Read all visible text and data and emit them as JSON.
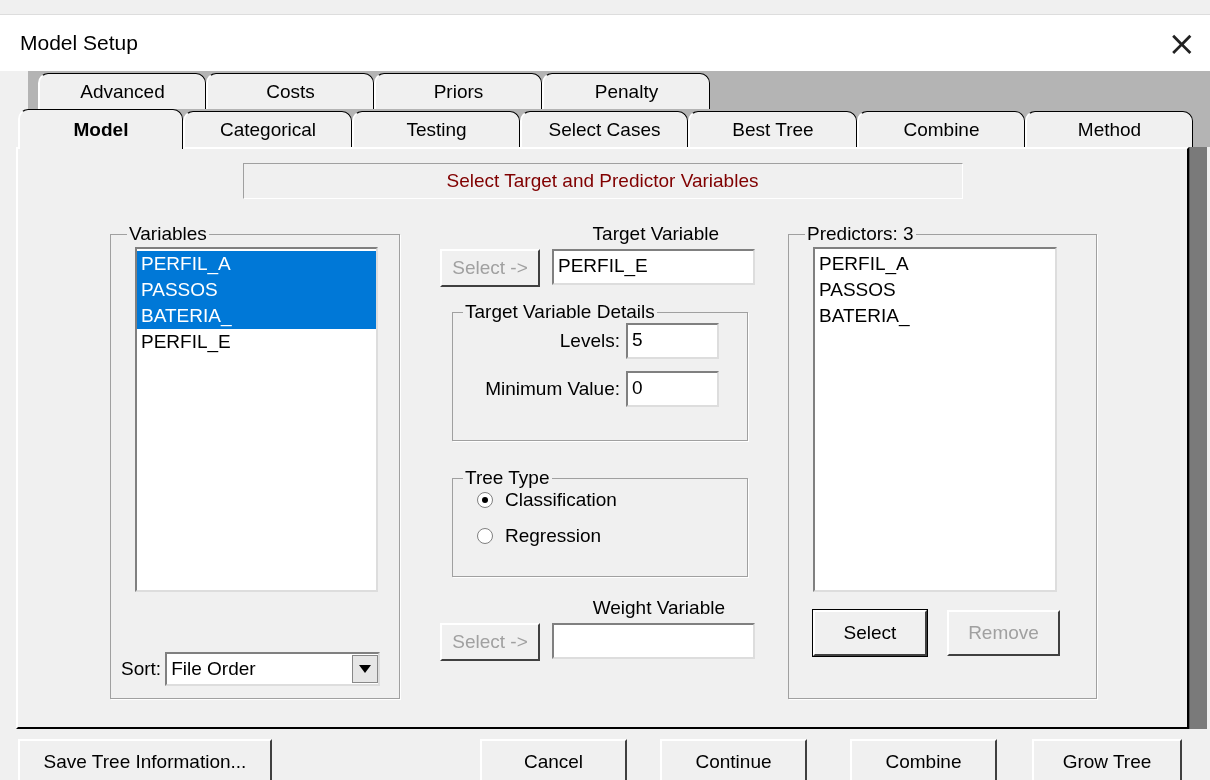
{
  "window": {
    "title": "Model Setup",
    "close": "×"
  },
  "tab_rows": [
    {
      "tabs": [
        {
          "label": "Advanced",
          "selected": false
        },
        {
          "label": "Costs",
          "selected": false
        },
        {
          "label": "Priors",
          "selected": false
        },
        {
          "label": "Penalty",
          "selected": false
        }
      ]
    },
    {
      "tabs": [
        {
          "label": "Model",
          "selected": true
        },
        {
          "label": "Categorical",
          "selected": false
        },
        {
          "label": "Testing",
          "selected": false
        },
        {
          "label": "Select Cases",
          "selected": false
        },
        {
          "label": "Best Tree",
          "selected": false
        },
        {
          "label": "Combine",
          "selected": false
        },
        {
          "label": "Method",
          "selected": false
        }
      ]
    }
  ],
  "heading": "Select Target and Predictor Variables",
  "variables": {
    "title": "Variables",
    "items": [
      {
        "label": "PERFIL_A",
        "selected": true
      },
      {
        "label": "PASSOS",
        "selected": true
      },
      {
        "label": "BATERIA_",
        "selected": true
      },
      {
        "label": "PERFIL_E",
        "selected": false
      }
    ],
    "sort_label": "Sort:",
    "sort_value": "File Order"
  },
  "target": {
    "label": "Target Variable",
    "button": {
      "label": "Select ->",
      "disabled": true
    },
    "value": "PERFIL_E"
  },
  "details": {
    "title": "Target Variable Details",
    "fields": [
      {
        "label": "Levels:",
        "value": "5"
      },
      {
        "label": "Minimum Value:",
        "value": "0"
      }
    ]
  },
  "tree_type": {
    "title": "Tree Type",
    "options": [
      {
        "label": "Classification",
        "selected": true
      },
      {
        "label": "Regression",
        "selected": false
      }
    ]
  },
  "weight": {
    "label": "Weight Variable",
    "button": {
      "label": "Select ->",
      "disabled": true
    }
  },
  "predictors": {
    "title": "Predictors: 3",
    "items": [
      {
        "label": "PERFIL_A",
        "selected": false
      },
      {
        "label": "PASSOS",
        "selected": false
      },
      {
        "label": "BATERIA_",
        "selected": false
      }
    ],
    "buttons": [
      {
        "label": "Select",
        "disabled": false
      },
      {
        "label": "Remove",
        "disabled": true
      }
    ]
  },
  "footer": [
    {
      "label": "Save Tree Information..."
    },
    {
      "label": "Cancel"
    },
    {
      "label": "Continue"
    },
    {
      "label": "Combine"
    },
    {
      "label": "Grow Tree"
    }
  ]
}
